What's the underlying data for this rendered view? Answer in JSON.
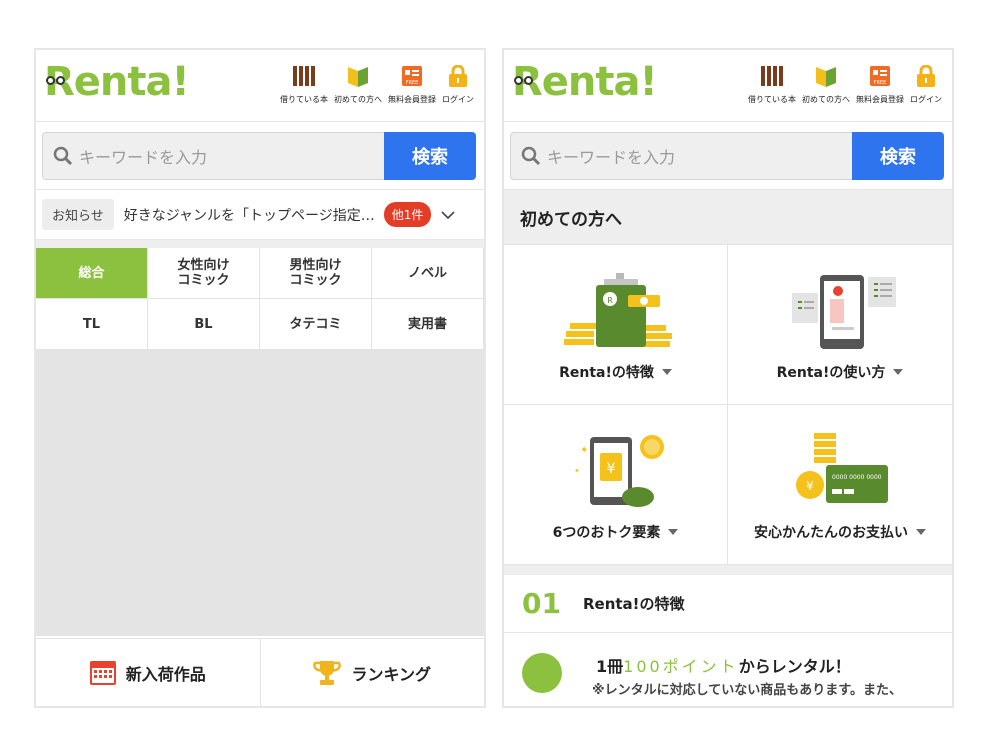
{
  "brand": {
    "logo_text": "Renta!",
    "accent": "#8bc13e",
    "button_blue": "#2f74ef",
    "badge_red": "#e33d28"
  },
  "header_nav": [
    {
      "label": "借りている本",
      "icon": "bookshelf-icon"
    },
    {
      "label": "初めての方へ",
      "icon": "beginner-mark-icon"
    },
    {
      "label": "無料会員登録",
      "icon": "free-member-icon"
    },
    {
      "label": "ログイン",
      "icon": "lock-icon"
    }
  ],
  "search": {
    "placeholder": "キーワードを入力",
    "button_label": "検索"
  },
  "notice": {
    "badge": "お知らせ",
    "text": "好きなジャンルを「トップページ指定…",
    "more_label": "他1件"
  },
  "categories": [
    {
      "label": "総合",
      "active": true
    },
    {
      "label": "女性向け\nコミック",
      "active": false
    },
    {
      "label": "男性向け\nコミック",
      "active": false
    },
    {
      "label": "ノベル",
      "active": false
    },
    {
      "label": "TL",
      "active": false
    },
    {
      "label": "BL",
      "active": false
    },
    {
      "label": "タテコミ",
      "active": false
    },
    {
      "label": "実用書",
      "active": false
    }
  ],
  "footer": {
    "new_arrivals": "新入荷作品",
    "ranking": "ランキング"
  },
  "beginner": {
    "title": "初めての方へ",
    "features": [
      {
        "label": "Renta!の特徴"
      },
      {
        "label": "Renta!の使い方"
      },
      {
        "label": "6つのおトク要素"
      },
      {
        "label": "安心かんたんのお支払い"
      }
    ],
    "point": {
      "number": "01",
      "title": "Renta!の特徴",
      "line1_prefix": "1冊",
      "line1_highlight": "100ポイント",
      "line1_suffix": "からレンタル！",
      "line2": "※レンタルに対応していない商品もあります。また、"
    },
    "card_text": "0000 0000 0000"
  }
}
